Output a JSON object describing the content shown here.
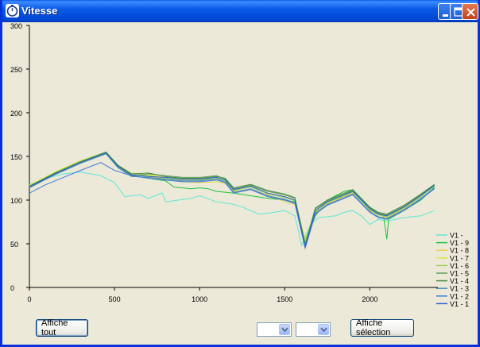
{
  "window": {
    "title": "Vitesse"
  },
  "controls": {
    "show_all_label": "Affiche tout",
    "show_selection_label": "Affiche sélection",
    "combo1_value": "",
    "combo2_value": ""
  },
  "chart_data": {
    "type": "line",
    "title": "",
    "xlabel": "",
    "ylabel": "",
    "xlim": [
      0,
      2400
    ],
    "ylim": [
      0,
      300
    ],
    "x_ticks": [
      0,
      500,
      1000,
      1500,
      2000
    ],
    "y_ticks": [
      0,
      50,
      100,
      150,
      200,
      250,
      300
    ],
    "legend_position": "bottom-right",
    "series": [
      {
        "name": "V1 -",
        "color": "#5ee8d8",
        "values": [
          [
            0,
            118
          ],
          [
            100,
            125
          ],
          [
            200,
            130
          ],
          [
            300,
            132
          ],
          [
            420,
            128
          ],
          [
            500,
            120
          ],
          [
            560,
            104
          ],
          [
            650,
            106
          ],
          [
            700,
            102
          ],
          [
            780,
            108
          ],
          [
            800,
            98
          ],
          [
            950,
            102
          ],
          [
            1000,
            105
          ],
          [
            1100,
            98
          ],
          [
            1200,
            95
          ],
          [
            1250,
            92
          ],
          [
            1300,
            88
          ],
          [
            1350,
            84
          ],
          [
            1400,
            85
          ],
          [
            1500,
            88
          ],
          [
            1560,
            82
          ],
          [
            1600,
            48
          ],
          [
            1650,
            72
          ],
          [
            1700,
            80
          ],
          [
            1800,
            82
          ],
          [
            1850,
            86
          ],
          [
            1900,
            88
          ],
          [
            1950,
            82
          ],
          [
            2000,
            72
          ],
          [
            2050,
            78
          ],
          [
            2100,
            76
          ],
          [
            2200,
            80
          ],
          [
            2300,
            82
          ],
          [
            2380,
            88
          ]
        ]
      },
      {
        "name": "V1 - 9",
        "color": "#1dc43b",
        "values": [
          [
            0,
            116
          ],
          [
            150,
            132
          ],
          [
            300,
            145
          ],
          [
            450,
            155
          ],
          [
            520,
            140
          ],
          [
            600,
            128
          ],
          [
            700,
            125
          ],
          [
            800,
            122
          ],
          [
            850,
            115
          ],
          [
            950,
            113
          ],
          [
            1000,
            114
          ],
          [
            1050,
            113
          ],
          [
            1100,
            110
          ],
          [
            1200,
            108
          ],
          [
            1300,
            105
          ],
          [
            1400,
            102
          ],
          [
            1500,
            100
          ],
          [
            1560,
            98
          ],
          [
            1620,
            52
          ],
          [
            1680,
            82
          ],
          [
            1750,
            100
          ],
          [
            1800,
            105
          ],
          [
            1850,
            110
          ],
          [
            1900,
            112
          ],
          [
            1950,
            102
          ],
          [
            2000,
            92
          ],
          [
            2050,
            85
          ],
          [
            2080,
            82
          ],
          [
            2100,
            55
          ],
          [
            2110,
            78
          ],
          [
            2200,
            88
          ],
          [
            2300,
            100
          ],
          [
            2380,
            115
          ]
        ]
      },
      {
        "name": "V1 - 8",
        "color": "#e8d24a",
        "values": [
          [
            0,
            116
          ],
          [
            150,
            131
          ],
          [
            300,
            144
          ],
          [
            450,
            154
          ],
          [
            520,
            139
          ],
          [
            600,
            129
          ],
          [
            700,
            127
          ],
          [
            800,
            124
          ],
          [
            900,
            121
          ],
          [
            1000,
            120
          ],
          [
            1100,
            121
          ],
          [
            1150,
            119
          ],
          [
            1200,
            110
          ],
          [
            1300,
            112
          ],
          [
            1400,
            106
          ],
          [
            1500,
            98
          ],
          [
            1560,
            95
          ],
          [
            1620,
            54
          ],
          [
            1680,
            86
          ],
          [
            1750,
            96
          ],
          [
            1850,
            104
          ],
          [
            1900,
            108
          ],
          [
            1950,
            100
          ],
          [
            2000,
            88
          ],
          [
            2050,
            83
          ],
          [
            2100,
            80
          ],
          [
            2200,
            90
          ],
          [
            2300,
            104
          ],
          [
            2380,
            116
          ]
        ]
      },
      {
        "name": "V1 - 7",
        "color": "#d8e840",
        "values": [
          [
            0,
            117
          ],
          [
            150,
            132
          ],
          [
            300,
            145
          ],
          [
            450,
            155
          ],
          [
            520,
            140
          ],
          [
            600,
            131
          ],
          [
            700,
            129
          ],
          [
            800,
            126
          ],
          [
            900,
            124
          ],
          [
            1000,
            124
          ],
          [
            1100,
            126
          ],
          [
            1150,
            123
          ],
          [
            1200,
            112
          ],
          [
            1300,
            116
          ],
          [
            1400,
            108
          ],
          [
            1500,
            104
          ],
          [
            1560,
            100
          ],
          [
            1620,
            55
          ],
          [
            1680,
            88
          ],
          [
            1750,
            98
          ],
          [
            1850,
            106
          ],
          [
            1900,
            110
          ],
          [
            1950,
            100
          ],
          [
            2000,
            90
          ],
          [
            2050,
            84
          ],
          [
            2100,
            82
          ],
          [
            2200,
            92
          ],
          [
            2300,
            105
          ],
          [
            2380,
            117
          ]
        ]
      },
      {
        "name": "V1 - 6",
        "color": "#9bd05a",
        "values": [
          [
            0,
            116
          ],
          [
            150,
            131
          ],
          [
            300,
            144
          ],
          [
            450,
            154
          ],
          [
            520,
            139
          ],
          [
            600,
            130
          ],
          [
            700,
            128
          ],
          [
            800,
            125
          ],
          [
            900,
            123
          ],
          [
            1000,
            123
          ],
          [
            1100,
            125
          ],
          [
            1150,
            122
          ],
          [
            1200,
            111
          ],
          [
            1300,
            115
          ],
          [
            1400,
            107
          ],
          [
            1500,
            103
          ],
          [
            1560,
            99
          ],
          [
            1620,
            53
          ],
          [
            1680,
            87
          ],
          [
            1750,
            97
          ],
          [
            1850,
            105
          ],
          [
            1900,
            109
          ],
          [
            1950,
            99
          ],
          [
            2000,
            89
          ],
          [
            2050,
            83
          ],
          [
            2100,
            81
          ],
          [
            2200,
            91
          ],
          [
            2300,
            104
          ],
          [
            2380,
            116
          ]
        ]
      },
      {
        "name": "V1 - 5",
        "color": "#5aa05a",
        "values": [
          [
            0,
            115
          ],
          [
            150,
            130
          ],
          [
            300,
            143
          ],
          [
            450,
            153
          ],
          [
            520,
            138
          ],
          [
            600,
            128
          ],
          [
            700,
            130
          ],
          [
            800,
            128
          ],
          [
            900,
            126
          ],
          [
            1000,
            126
          ],
          [
            1100,
            128
          ],
          [
            1150,
            124
          ],
          [
            1200,
            113
          ],
          [
            1300,
            117
          ],
          [
            1400,
            110
          ],
          [
            1500,
            106
          ],
          [
            1560,
            102
          ],
          [
            1620,
            50
          ],
          [
            1680,
            90
          ],
          [
            1750,
            99
          ],
          [
            1850,
            107
          ],
          [
            1900,
            111
          ],
          [
            1950,
            101
          ],
          [
            2000,
            91
          ],
          [
            2050,
            85
          ],
          [
            2100,
            83
          ],
          [
            2200,
            93
          ],
          [
            2300,
            106
          ],
          [
            2380,
            117
          ]
        ]
      },
      {
        "name": "V1 - 4",
        "color": "#4a8c4a",
        "values": [
          [
            0,
            116
          ],
          [
            150,
            131
          ],
          [
            300,
            144
          ],
          [
            450,
            155
          ],
          [
            520,
            140
          ],
          [
            600,
            130
          ],
          [
            700,
            131
          ],
          [
            800,
            127
          ],
          [
            900,
            125
          ],
          [
            1000,
            125
          ],
          [
            1100,
            127
          ],
          [
            1150,
            125
          ],
          [
            1200,
            114
          ],
          [
            1300,
            118
          ],
          [
            1400,
            111
          ],
          [
            1500,
            107
          ],
          [
            1560,
            103
          ],
          [
            1620,
            49
          ],
          [
            1680,
            91
          ],
          [
            1750,
            100
          ],
          [
            1850,
            108
          ],
          [
            1900,
            112
          ],
          [
            1950,
            102
          ],
          [
            2000,
            92
          ],
          [
            2050,
            86
          ],
          [
            2100,
            84
          ],
          [
            2200,
            94
          ],
          [
            2300,
            107
          ],
          [
            2380,
            118
          ]
        ]
      },
      {
        "name": "V1 - 3",
        "color": "#4d8fb5",
        "values": [
          [
            0,
            114
          ],
          [
            150,
            129
          ],
          [
            300,
            142
          ],
          [
            450,
            153
          ],
          [
            520,
            137
          ],
          [
            600,
            127
          ],
          [
            700,
            126
          ],
          [
            800,
            124
          ],
          [
            900,
            122
          ],
          [
            1000,
            122
          ],
          [
            1100,
            124
          ],
          [
            1150,
            121
          ],
          [
            1200,
            109
          ],
          [
            1300,
            113
          ],
          [
            1400,
            105
          ],
          [
            1500,
            101
          ],
          [
            1560,
            97
          ],
          [
            1620,
            47
          ],
          [
            1680,
            85
          ],
          [
            1750,
            95
          ],
          [
            1850,
            103
          ],
          [
            1900,
            107
          ],
          [
            1950,
            97
          ],
          [
            2000,
            87
          ],
          [
            2050,
            81
          ],
          [
            2100,
            79
          ],
          [
            2200,
            89
          ],
          [
            2300,
            102
          ],
          [
            2380,
            114
          ]
        ]
      },
      {
        "name": "V1 - 2",
        "color": "#3d7bd9",
        "values": [
          [
            0,
            108
          ],
          [
            100,
            118
          ],
          [
            200,
            126
          ],
          [
            300,
            134
          ],
          [
            420,
            143
          ],
          [
            500,
            134
          ],
          [
            600,
            128
          ],
          [
            700,
            125
          ],
          [
            800,
            123
          ],
          [
            900,
            121
          ],
          [
            1000,
            121
          ],
          [
            1100,
            123
          ],
          [
            1150,
            120
          ],
          [
            1200,
            108
          ],
          [
            1300,
            112
          ],
          [
            1400,
            104
          ],
          [
            1500,
            100
          ],
          [
            1560,
            96
          ],
          [
            1620,
            45
          ],
          [
            1680,
            84
          ],
          [
            1750,
            94
          ],
          [
            1850,
            102
          ],
          [
            1900,
            106
          ],
          [
            1950,
            96
          ],
          [
            2000,
            86
          ],
          [
            2050,
            80
          ],
          [
            2100,
            78
          ],
          [
            2200,
            88
          ],
          [
            2300,
            101
          ],
          [
            2380,
            113
          ]
        ]
      },
      {
        "name": "V1 - 1",
        "color": "#2c5fd0",
        "values": [
          [
            0,
            115
          ],
          [
            150,
            130
          ],
          [
            300,
            143
          ],
          [
            450,
            154
          ],
          [
            520,
            139
          ],
          [
            600,
            129
          ],
          [
            700,
            127
          ],
          [
            800,
            126
          ],
          [
            900,
            124
          ],
          [
            1000,
            124
          ],
          [
            1100,
            126
          ],
          [
            1150,
            123
          ],
          [
            1200,
            112
          ],
          [
            1300,
            116
          ],
          [
            1400,
            108
          ],
          [
            1500,
            104
          ],
          [
            1560,
            100
          ],
          [
            1620,
            46
          ],
          [
            1680,
            88
          ],
          [
            1750,
            98
          ],
          [
            1850,
            106
          ],
          [
            1900,
            110
          ],
          [
            1950,
            100
          ],
          [
            2000,
            90
          ],
          [
            2050,
            84
          ],
          [
            2100,
            82
          ],
          [
            2200,
            92
          ],
          [
            2300,
            105
          ],
          [
            2380,
            117
          ]
        ]
      }
    ]
  }
}
